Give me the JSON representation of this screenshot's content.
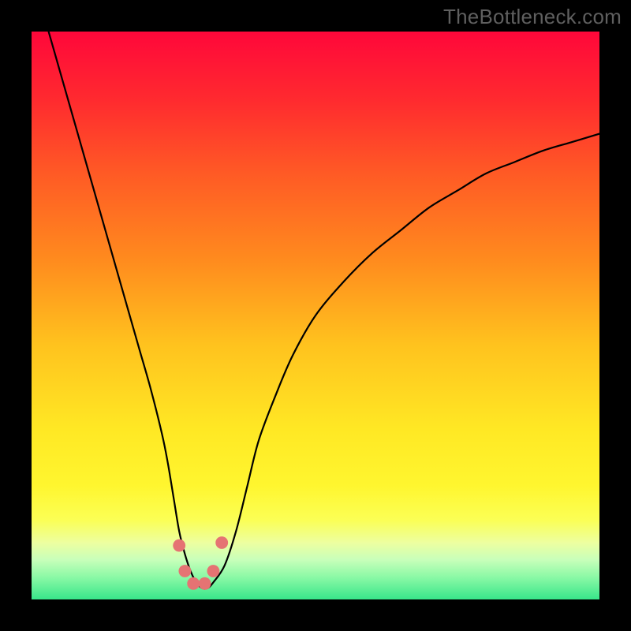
{
  "watermark": "TheBottleneck.com",
  "chart_data": {
    "type": "line",
    "title": "",
    "xlabel": "",
    "ylabel": "",
    "xlim": [
      0,
      100
    ],
    "ylim": [
      0,
      100
    ],
    "grid": false,
    "legend": false,
    "background_gradient": {
      "stops": [
        {
          "offset": 0.0,
          "color": "#ff073a"
        },
        {
          "offset": 0.12,
          "color": "#ff2a2f"
        },
        {
          "offset": 0.25,
          "color": "#ff5a25"
        },
        {
          "offset": 0.4,
          "color": "#ff8a1e"
        },
        {
          "offset": 0.55,
          "color": "#ffc21e"
        },
        {
          "offset": 0.7,
          "color": "#ffe824"
        },
        {
          "offset": 0.8,
          "color": "#fff62f"
        },
        {
          "offset": 0.86,
          "color": "#fbff55"
        },
        {
          "offset": 0.9,
          "color": "#edffa0"
        },
        {
          "offset": 0.93,
          "color": "#c8ffba"
        },
        {
          "offset": 0.96,
          "color": "#8cf9a6"
        },
        {
          "offset": 1.0,
          "color": "#38e68a"
        }
      ]
    },
    "curve": {
      "x": [
        3,
        5,
        7,
        9,
        11,
        13,
        15,
        17,
        19,
        21,
        23,
        24,
        25,
        26,
        27,
        28,
        29,
        30,
        31,
        32,
        34,
        36,
        38,
        40,
        43,
        46,
        50,
        55,
        60,
        65,
        70,
        75,
        80,
        85,
        90,
        95,
        100
      ],
      "y": [
        100,
        93,
        86,
        79,
        72,
        65,
        58,
        51,
        44,
        37,
        29,
        24,
        18,
        12,
        8,
        5,
        3,
        2,
        2,
        3,
        6,
        12,
        20,
        28,
        36,
        43,
        50,
        56,
        61,
        65,
        69,
        72,
        75,
        77,
        79,
        80.5,
        82
      ]
    },
    "markers": {
      "color": "#e57373",
      "radius_pct": 1.1,
      "points": [
        {
          "x": 26.0,
          "y": 9.5
        },
        {
          "x": 27.0,
          "y": 5.0
        },
        {
          "x": 28.5,
          "y": 2.8
        },
        {
          "x": 30.5,
          "y": 2.8
        },
        {
          "x": 32.0,
          "y": 5.0
        },
        {
          "x": 33.5,
          "y": 10.0
        }
      ]
    }
  }
}
